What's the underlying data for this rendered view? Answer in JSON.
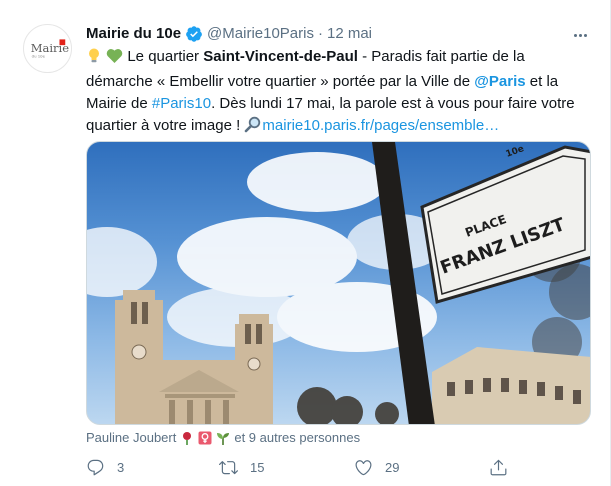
{
  "tweet": {
    "author_name": "Mairie du 10e",
    "author_handle": "@Mairie10Paris",
    "separator": "·",
    "timestamp": "12 mai",
    "avatar_text": "Mairie",
    "text": {
      "intro": " Le quartier ",
      "bold_place": "Saint-Vincent-de-Paul",
      "after_place": " - Paradis fait partie de la démarche « Embellir votre quartier » portée par la Ville de ",
      "mention": "@Paris",
      "after_mention": " et la Mairie de ",
      "hashtag": "#Paris10",
      "after_hashtag": ". Dès lundi 17 mai, la parole est à vous pour faire votre quartier à votre image ! ",
      "url": "mairie10.paris.fr/pages/ensemble…"
    },
    "media": {
      "sign_line1": "PLACE",
      "sign_line2": "FRANZ LISZT",
      "sign_number": "10e"
    },
    "likers": {
      "first": "Pauline Joubert",
      "others": "et 9 autres personnes"
    },
    "actions": {
      "replies": "3",
      "retweets": "15",
      "likes": "29"
    }
  },
  "colors": {
    "link": "#1b95e0",
    "secondary_text": "#5b7083",
    "verified": "#1da1f2"
  },
  "icons": [
    "verified-badge-icon",
    "more-icon",
    "lightbulb-emoji",
    "green-heart-emoji",
    "magnifier-emoji",
    "reply-icon",
    "retweet-icon",
    "like-icon",
    "share-icon",
    "rose-emoji",
    "female-sign-emoji",
    "seedling-emoji"
  ]
}
